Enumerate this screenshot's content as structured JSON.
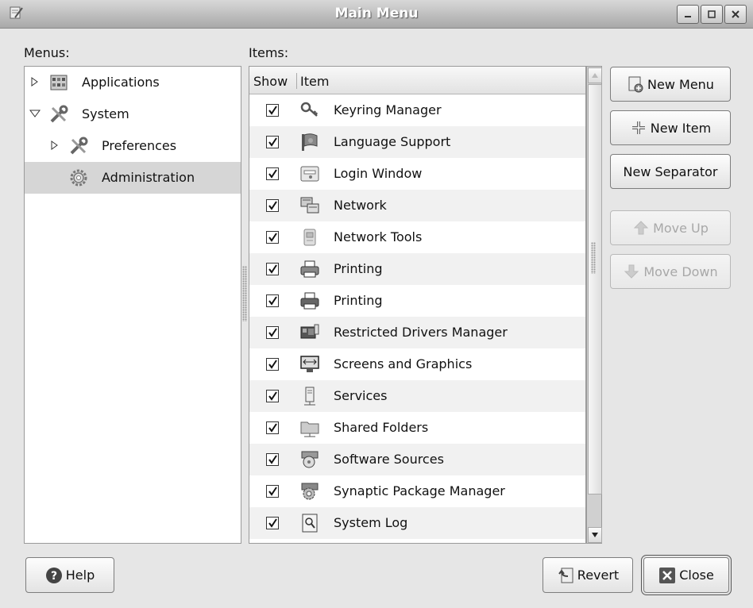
{
  "window": {
    "title": "Main Menu"
  },
  "menus_label": "Menus:",
  "items_label": "Items:",
  "tree": [
    {
      "label": "Applications",
      "expanded": false,
      "icon": "applications-icon"
    },
    {
      "label": "System",
      "expanded": true,
      "icon": "system-tools-icon"
    },
    {
      "label": "Preferences",
      "expanded": false,
      "icon": "preferences-icon"
    },
    {
      "label": "Administration",
      "selected": true,
      "icon": "administration-gear-icon"
    }
  ],
  "columns": {
    "show": "Show",
    "item": "Item"
  },
  "items": [
    {
      "label": "Keyring Manager",
      "checked": true,
      "icon": "keyring-icon"
    },
    {
      "label": "Language Support",
      "checked": true,
      "icon": "flag-icon"
    },
    {
      "label": "Login Window",
      "checked": true,
      "icon": "login-window-icon"
    },
    {
      "label": "Network",
      "checked": true,
      "icon": "network-icon"
    },
    {
      "label": "Network Tools",
      "checked": true,
      "icon": "network-tools-icon"
    },
    {
      "label": "Printing",
      "checked": true,
      "icon": "printer-icon"
    },
    {
      "label": "Printing",
      "checked": true,
      "icon": "printer-icon"
    },
    {
      "label": "Restricted Drivers Manager",
      "checked": true,
      "icon": "hardware-card-icon"
    },
    {
      "label": "Screens and Graphics",
      "checked": true,
      "icon": "monitor-icon"
    },
    {
      "label": "Services",
      "checked": true,
      "icon": "server-icon"
    },
    {
      "label": "Shared Folders",
      "checked": true,
      "icon": "shared-folder-icon"
    },
    {
      "label": "Software Sources",
      "checked": true,
      "icon": "software-sources-icon"
    },
    {
      "label": "Synaptic Package Manager",
      "checked": true,
      "icon": "package-manager-icon"
    },
    {
      "label": "System Log",
      "checked": true,
      "icon": "log-viewer-icon"
    }
  ],
  "buttons": {
    "new_menu": "New Menu",
    "new_item": "New Item",
    "new_separator": "New Separator",
    "move_up": "Move Up",
    "move_down": "Move Down",
    "help": "Help",
    "revert": "Revert",
    "close": "Close"
  }
}
